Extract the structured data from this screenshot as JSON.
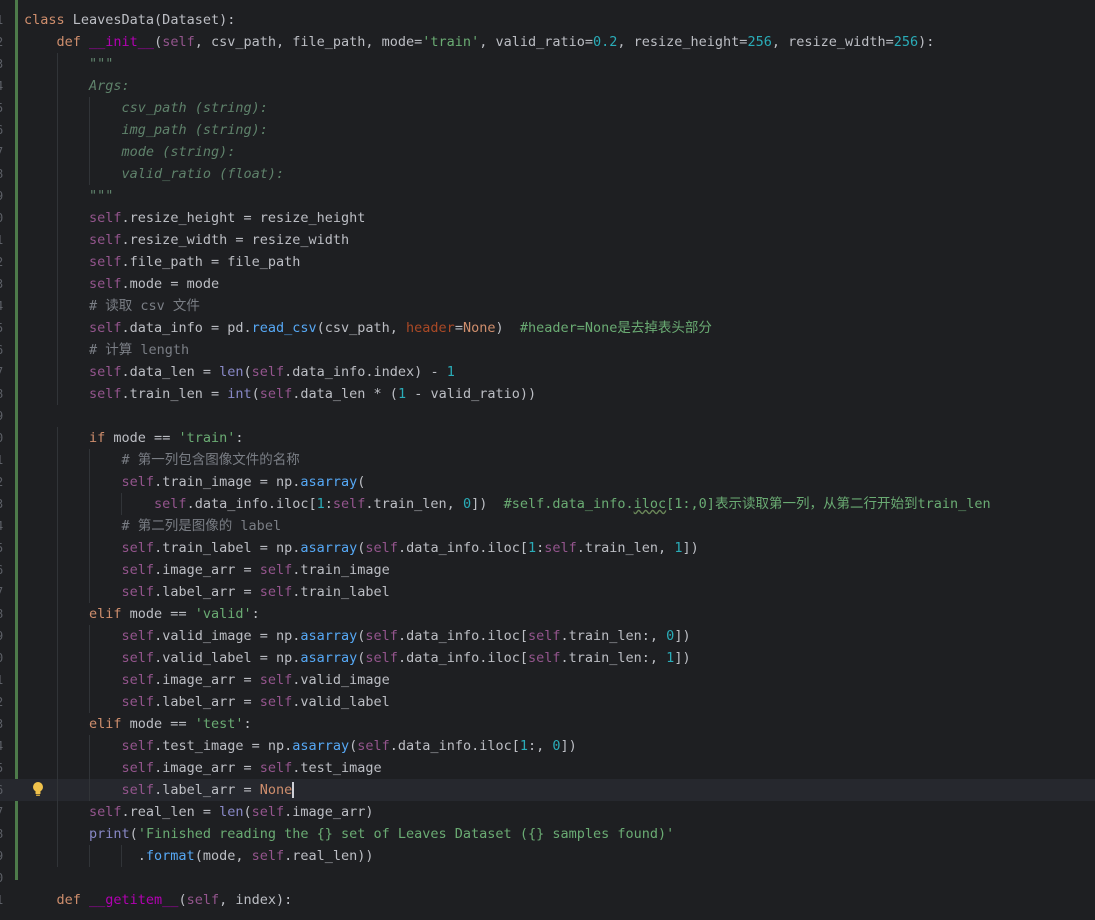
{
  "editor": {
    "language": "python",
    "caret_line": 36,
    "colors": {
      "background": "#1e1f22",
      "keyword": "#cf8e6d",
      "function": "#56a8f5",
      "string": "#6aab73",
      "number": "#2aacb8",
      "comment": "#7a7e85",
      "docstring": "#5f826b",
      "self": "#94558d",
      "current_line": "#26282e"
    },
    "icons": {
      "intention": "lightbulb-icon"
    },
    "lines": [
      {
        "n": "1",
        "tokens": [
          {
            "t": "class ",
            "c": "kw"
          },
          {
            "t": "LeavesData(Dataset):"
          }
        ]
      },
      {
        "n": "2",
        "tokens": [
          {
            "t": "    "
          },
          {
            "t": "def ",
            "c": "kw"
          },
          {
            "t": "__init__",
            "c": "mg"
          },
          {
            "t": "("
          },
          {
            "t": "self",
            "c": "sf"
          },
          {
            "t": ", csv_path, file_path, mode="
          },
          {
            "t": "'train'",
            "c": "st"
          },
          {
            "t": ", valid_ratio="
          },
          {
            "t": "0.2",
            "c": "nu"
          },
          {
            "t": ", resize_height="
          },
          {
            "t": "256",
            "c": "nu"
          },
          {
            "t": ", resize_width="
          },
          {
            "t": "256",
            "c": "nu"
          },
          {
            "t": "):"
          }
        ]
      },
      {
        "n": "3",
        "tokens": [
          {
            "t": "        "
          },
          {
            "t": "\"\"\"",
            "c": "dc"
          }
        ]
      },
      {
        "n": "4",
        "tokens": [
          {
            "t": "        "
          },
          {
            "t": "Args:",
            "c": "dc"
          }
        ]
      },
      {
        "n": "5",
        "tokens": [
          {
            "t": "            "
          },
          {
            "t": "csv_path (string):",
            "c": "dc"
          }
        ]
      },
      {
        "n": "6",
        "tokens": [
          {
            "t": "            "
          },
          {
            "t": "img_path (string):",
            "c": "dc"
          }
        ]
      },
      {
        "n": "7",
        "tokens": [
          {
            "t": "            "
          },
          {
            "t": "mode (string):",
            "c": "dc"
          }
        ]
      },
      {
        "n": "8",
        "tokens": [
          {
            "t": "            "
          },
          {
            "t": "valid_ratio (float):",
            "c": "dc"
          }
        ]
      },
      {
        "n": "9",
        "tokens": [
          {
            "t": "        "
          },
          {
            "t": "\"\"\"",
            "c": "dc"
          }
        ]
      },
      {
        "n": "0",
        "tokens": [
          {
            "t": "        "
          },
          {
            "t": "self",
            "c": "sf"
          },
          {
            "t": ".resize_height = resize_height"
          }
        ]
      },
      {
        "n": "1",
        "tokens": [
          {
            "t": "        "
          },
          {
            "t": "self",
            "c": "sf"
          },
          {
            "t": ".resize_width = resize_width"
          }
        ]
      },
      {
        "n": "2",
        "tokens": [
          {
            "t": "        "
          },
          {
            "t": "self",
            "c": "sf"
          },
          {
            "t": ".file_path = file_path"
          }
        ]
      },
      {
        "n": "3",
        "tokens": [
          {
            "t": "        "
          },
          {
            "t": "self",
            "c": "sf"
          },
          {
            "t": ".mode = mode"
          }
        ]
      },
      {
        "n": "4",
        "tokens": [
          {
            "t": "        "
          },
          {
            "t": "# 读取 csv 文件",
            "c": "cm"
          }
        ]
      },
      {
        "n": "5",
        "tokens": [
          {
            "t": "        "
          },
          {
            "t": "self",
            "c": "sf"
          },
          {
            "t": ".data_info = pd."
          },
          {
            "t": "read_csv",
            "c": "fn"
          },
          {
            "t": "(csv_path, "
          },
          {
            "t": "header",
            "c": "pm"
          },
          {
            "t": "="
          },
          {
            "t": "None",
            "c": "kw"
          },
          {
            "t": ")  "
          },
          {
            "t": "#header=None是去掉表头部分",
            "c": "st"
          }
        ]
      },
      {
        "n": "6",
        "tokens": [
          {
            "t": "        "
          },
          {
            "t": "# 计算 length",
            "c": "cm"
          }
        ]
      },
      {
        "n": "7",
        "tokens": [
          {
            "t": "        "
          },
          {
            "t": "self",
            "c": "sf"
          },
          {
            "t": ".data_len = "
          },
          {
            "t": "len",
            "c": "bi"
          },
          {
            "t": "("
          },
          {
            "t": "self",
            "c": "sf"
          },
          {
            "t": ".data_info.index) - "
          },
          {
            "t": "1",
            "c": "nu"
          }
        ]
      },
      {
        "n": "8",
        "tokens": [
          {
            "t": "        "
          },
          {
            "t": "self",
            "c": "sf"
          },
          {
            "t": ".train_len = "
          },
          {
            "t": "int",
            "c": "bi"
          },
          {
            "t": "("
          },
          {
            "t": "self",
            "c": "sf"
          },
          {
            "t": ".data_len * ("
          },
          {
            "t": "1",
            "c": "nu"
          },
          {
            "t": " - valid_ratio))"
          }
        ]
      },
      {
        "n": "9",
        "tokens": []
      },
      {
        "n": "0",
        "tokens": [
          {
            "t": "        "
          },
          {
            "t": "if ",
            "c": "kw"
          },
          {
            "t": "mode == "
          },
          {
            "t": "'train'",
            "c": "st"
          },
          {
            "t": ":"
          }
        ]
      },
      {
        "n": "1",
        "tokens": [
          {
            "t": "            "
          },
          {
            "t": "# 第一列包含图像文件的名称",
            "c": "cm"
          }
        ]
      },
      {
        "n": "2",
        "tokens": [
          {
            "t": "            "
          },
          {
            "t": "self",
            "c": "sf"
          },
          {
            "t": ".train_image = np."
          },
          {
            "t": "asarray",
            "c": "fn"
          },
          {
            "t": "("
          }
        ]
      },
      {
        "n": "3",
        "tokens": [
          {
            "t": "                "
          },
          {
            "t": "self",
            "c": "sf"
          },
          {
            "t": ".data_info.iloc["
          },
          {
            "t": "1",
            "c": "nu"
          },
          {
            "t": ":"
          },
          {
            "t": "self",
            "c": "sf"
          },
          {
            "t": ".train_len, "
          },
          {
            "t": "0",
            "c": "nu"
          },
          {
            "t": "])  "
          },
          {
            "t": "#self.data_info.",
            "c": "st"
          },
          {
            "t": "iloc",
            "c": "st typo"
          },
          {
            "t": "[1:,0]表示读取第一列，从第二行开始到train_len",
            "c": "st"
          }
        ]
      },
      {
        "n": "4",
        "tokens": [
          {
            "t": "            "
          },
          {
            "t": "# 第二列是图像的 label",
            "c": "cm"
          }
        ]
      },
      {
        "n": "5",
        "tokens": [
          {
            "t": "            "
          },
          {
            "t": "self",
            "c": "sf"
          },
          {
            "t": ".train_label = np."
          },
          {
            "t": "asarray",
            "c": "fn"
          },
          {
            "t": "("
          },
          {
            "t": "self",
            "c": "sf"
          },
          {
            "t": ".data_info.iloc["
          },
          {
            "t": "1",
            "c": "nu"
          },
          {
            "t": ":"
          },
          {
            "t": "self",
            "c": "sf"
          },
          {
            "t": ".train_len, "
          },
          {
            "t": "1",
            "c": "nu"
          },
          {
            "t": "])"
          }
        ]
      },
      {
        "n": "6",
        "tokens": [
          {
            "t": "            "
          },
          {
            "t": "self",
            "c": "sf"
          },
          {
            "t": ".image_arr = "
          },
          {
            "t": "self",
            "c": "sf"
          },
          {
            "t": ".train_image"
          }
        ]
      },
      {
        "n": "7",
        "tokens": [
          {
            "t": "            "
          },
          {
            "t": "self",
            "c": "sf"
          },
          {
            "t": ".label_arr = "
          },
          {
            "t": "self",
            "c": "sf"
          },
          {
            "t": ".train_label"
          }
        ]
      },
      {
        "n": "8",
        "tokens": [
          {
            "t": "        "
          },
          {
            "t": "elif ",
            "c": "kw"
          },
          {
            "t": "mode == "
          },
          {
            "t": "'valid'",
            "c": "st"
          },
          {
            "t": ":"
          }
        ]
      },
      {
        "n": "9",
        "tokens": [
          {
            "t": "            "
          },
          {
            "t": "self",
            "c": "sf"
          },
          {
            "t": ".valid_image = np."
          },
          {
            "t": "asarray",
            "c": "fn"
          },
          {
            "t": "("
          },
          {
            "t": "self",
            "c": "sf"
          },
          {
            "t": ".data_info.iloc["
          },
          {
            "t": "self",
            "c": "sf"
          },
          {
            "t": ".train_len:, "
          },
          {
            "t": "0",
            "c": "nu"
          },
          {
            "t": "])"
          }
        ]
      },
      {
        "n": "0",
        "tokens": [
          {
            "t": "            "
          },
          {
            "t": "self",
            "c": "sf"
          },
          {
            "t": ".valid_label = np."
          },
          {
            "t": "asarray",
            "c": "fn"
          },
          {
            "t": "("
          },
          {
            "t": "self",
            "c": "sf"
          },
          {
            "t": ".data_info.iloc["
          },
          {
            "t": "self",
            "c": "sf"
          },
          {
            "t": ".train_len:, "
          },
          {
            "t": "1",
            "c": "nu"
          },
          {
            "t": "])"
          }
        ]
      },
      {
        "n": "1",
        "tokens": [
          {
            "t": "            "
          },
          {
            "t": "self",
            "c": "sf"
          },
          {
            "t": ".image_arr = "
          },
          {
            "t": "self",
            "c": "sf"
          },
          {
            "t": ".valid_image"
          }
        ]
      },
      {
        "n": "2",
        "tokens": [
          {
            "t": "            "
          },
          {
            "t": "self",
            "c": "sf"
          },
          {
            "t": ".label_arr = "
          },
          {
            "t": "self",
            "c": "sf"
          },
          {
            "t": ".valid_label"
          }
        ]
      },
      {
        "n": "3",
        "tokens": [
          {
            "t": "        "
          },
          {
            "t": "elif ",
            "c": "kw"
          },
          {
            "t": "mode == "
          },
          {
            "t": "'test'",
            "c": "st"
          },
          {
            "t": ":"
          }
        ]
      },
      {
        "n": "4",
        "tokens": [
          {
            "t": "            "
          },
          {
            "t": "self",
            "c": "sf"
          },
          {
            "t": ".test_image = np."
          },
          {
            "t": "asarray",
            "c": "fn"
          },
          {
            "t": "("
          },
          {
            "t": "self",
            "c": "sf"
          },
          {
            "t": ".data_info.iloc["
          },
          {
            "t": "1",
            "c": "nu"
          },
          {
            "t": ":, "
          },
          {
            "t": "0",
            "c": "nu"
          },
          {
            "t": "])"
          }
        ]
      },
      {
        "n": "5",
        "tokens": [
          {
            "t": "            "
          },
          {
            "t": "self",
            "c": "sf"
          },
          {
            "t": ".image_arr = "
          },
          {
            "t": "self",
            "c": "sf"
          },
          {
            "t": ".test_image"
          }
        ]
      },
      {
        "n": "6",
        "tokens": [
          {
            "t": "            "
          },
          {
            "t": "self",
            "c": "sf"
          },
          {
            "t": ".label_arr = "
          },
          {
            "t": "None",
            "c": "kw"
          }
        ]
      },
      {
        "n": "7",
        "tokens": [
          {
            "t": "        "
          },
          {
            "t": "self",
            "c": "sf"
          },
          {
            "t": ".real_len = "
          },
          {
            "t": "len",
            "c": "bi"
          },
          {
            "t": "("
          },
          {
            "t": "self",
            "c": "sf"
          },
          {
            "t": ".image_arr)"
          }
        ]
      },
      {
        "n": "8",
        "tokens": [
          {
            "t": "        "
          },
          {
            "t": "print",
            "c": "bi"
          },
          {
            "t": "("
          },
          {
            "t": "'Finished reading the {} set of Leaves Dataset ({} samples found)'",
            "c": "st"
          }
        ]
      },
      {
        "n": "9",
        "tokens": [
          {
            "t": "              ."
          },
          {
            "t": "format",
            "c": "fn"
          },
          {
            "t": "(mode, "
          },
          {
            "t": "self",
            "c": "sf"
          },
          {
            "t": ".real_len))"
          }
        ]
      },
      {
        "n": "0",
        "tokens": []
      },
      {
        "n": "1",
        "tokens": [
          {
            "t": "    "
          },
          {
            "t": "def ",
            "c": "kw"
          },
          {
            "t": "__getitem__",
            "c": "mg"
          },
          {
            "t": "("
          },
          {
            "t": "self",
            "c": "sf"
          },
          {
            "t": ", index):"
          }
        ]
      }
    ]
  }
}
